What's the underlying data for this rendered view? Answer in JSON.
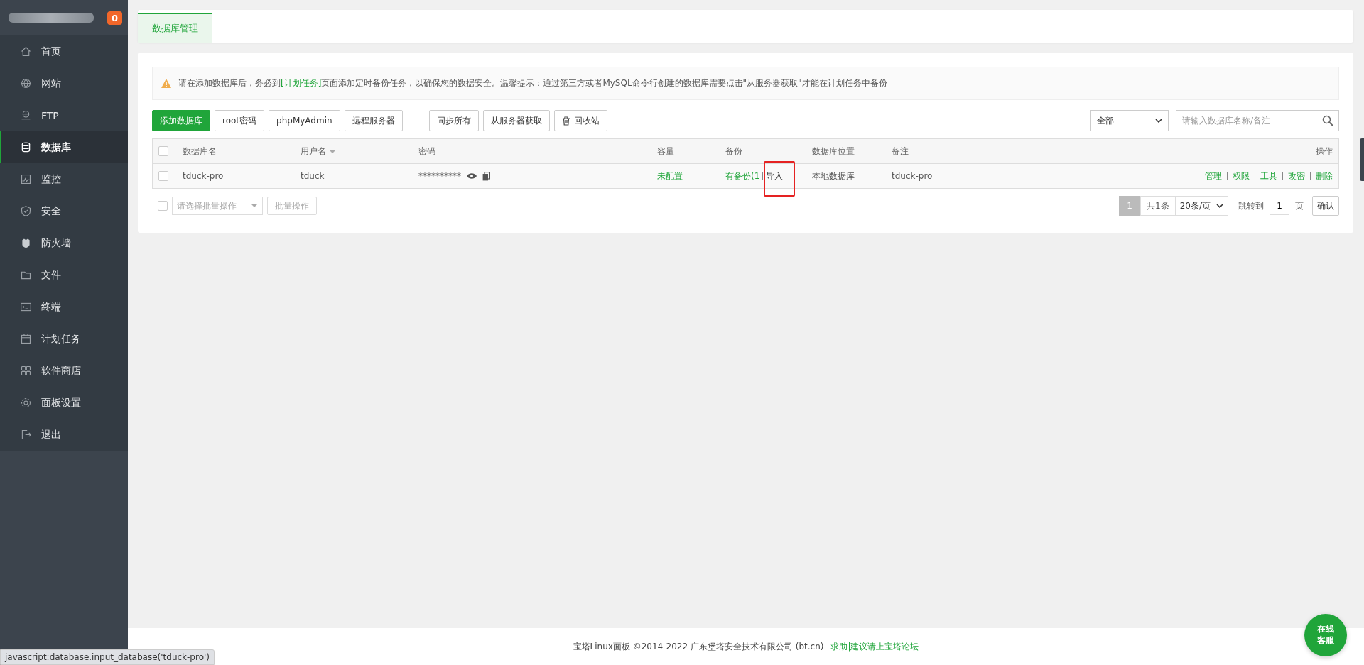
{
  "sidebar": {
    "badge": "0",
    "items": [
      {
        "label": "首页",
        "selected": false
      },
      {
        "label": "网站",
        "selected": false
      },
      {
        "label": "FTP",
        "selected": false
      },
      {
        "label": "数据库",
        "selected": true
      },
      {
        "label": "监控",
        "selected": false
      },
      {
        "label": "安全",
        "selected": false
      },
      {
        "label": "防火墙",
        "selected": false
      },
      {
        "label": "文件",
        "selected": false
      },
      {
        "label": "终端",
        "selected": false
      },
      {
        "label": "计划任务",
        "selected": false
      },
      {
        "label": "软件商店",
        "selected": false
      },
      {
        "label": "面板设置",
        "selected": false
      },
      {
        "label": "退出",
        "selected": false
      }
    ]
  },
  "tabs": [
    {
      "label": "数据库管理",
      "selected": true
    }
  ],
  "notice": {
    "before": "请在添加数据库后，务必到",
    "link": "[计划任务]",
    "after": "页面添加定时备份任务，以确保您的数据安全。温馨提示：通过第三方或者MySQL命令行创建的数据库需要点击\"从服务器获取\"才能在计划任务中备份"
  },
  "toolbar": {
    "primary": "添加数据库",
    "buttons": [
      {
        "label": "root密码"
      },
      {
        "label": "phpMyAdmin"
      },
      {
        "label": "远程服务器"
      },
      {
        "label": "同步所有"
      },
      {
        "label": "从服务器获取"
      },
      {
        "label": "回收站"
      }
    ]
  },
  "filter": {
    "value": "全部",
    "placeholder": "请输入数据库名称/备注"
  },
  "table": {
    "header_checked": false,
    "columns": [
      {
        "label": "数据库名"
      },
      {
        "label": "用户名"
      },
      {
        "label": "密码"
      },
      {
        "label": "容量"
      },
      {
        "label": "备份"
      },
      {
        "label": "数据库位置"
      },
      {
        "label": "备注"
      },
      {
        "label": "操作"
      }
    ],
    "rows": [
      {
        "checked": false,
        "name": "tduck-pro",
        "user": "tduck",
        "password": "**********",
        "capacity": "未配置",
        "backup": "有备份(1",
        "import": "导入",
        "location": "本地数据库",
        "note": "tduck-pro",
        "actions": [
          "管理",
          "权限",
          "工具",
          "改密",
          "删除"
        ]
      }
    ]
  },
  "batch": {
    "checked": false,
    "placeholder": "请选择批量操作",
    "button": "批量操作"
  },
  "pagination": {
    "current": "1",
    "total": "共1条",
    "per_page": "20条/页",
    "jump_label": "跳转到",
    "jump_value": "1",
    "page_unit": "页",
    "confirm": "确认"
  },
  "footer": {
    "copyright": "宝塔Linux面板 ©2014-2022 广东堡塔安全技术有限公司 (bt.cn)",
    "link": "求助|建议请上宝塔论坛"
  },
  "chat_button": "在线客服",
  "status_url": "javascript:database.input_database('tduck-pro')"
}
